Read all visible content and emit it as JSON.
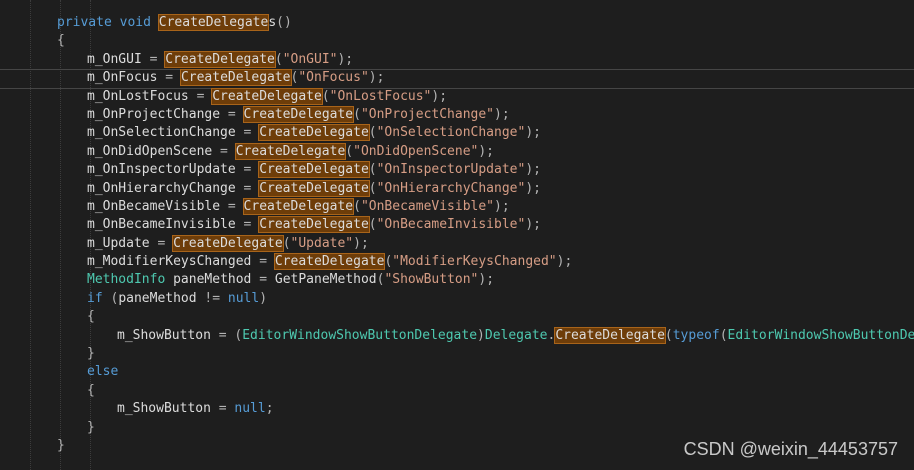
{
  "code": {
    "method_signature": {
      "keyword_private": "private",
      "keyword_void": "void",
      "method_name_highlight": "CreateDelegate",
      "method_name_suffix": "s",
      "parens": "()"
    },
    "open_brace": "{",
    "assignments": [
      {
        "target": "m_OnGUI",
        "fn": "CreateDelegate",
        "arg": "\"OnGUI\""
      },
      {
        "target": "m_OnFocus",
        "fn": "CreateDelegate",
        "arg": "\"OnFocus\""
      },
      {
        "target": "m_OnLostFocus",
        "fn": "CreateDelegate",
        "arg": "\"OnLostFocus\""
      },
      {
        "target": "m_OnProjectChange",
        "fn": "CreateDelegate",
        "arg": "\"OnProjectChange\""
      },
      {
        "target": "m_OnSelectionChange",
        "fn": "CreateDelegate",
        "arg": "\"OnSelectionChange\""
      },
      {
        "target": "m_OnDidOpenScene",
        "fn": "CreateDelegate",
        "arg": "\"OnDidOpenScene\""
      },
      {
        "target": "m_OnInspectorUpdate",
        "fn": "CreateDelegate",
        "arg": "\"OnInspectorUpdate\""
      },
      {
        "target": "m_OnHierarchyChange",
        "fn": "CreateDelegate",
        "arg": "\"OnHierarchyChange\""
      },
      {
        "target": "m_OnBecameVisible",
        "fn": "CreateDelegate",
        "arg": "\"OnBecameVisible\""
      },
      {
        "target": "m_OnBecameInvisible",
        "fn": "CreateDelegate",
        "arg": "\"OnBecameInvisible\""
      },
      {
        "target": "m_Update",
        "fn": "CreateDelegate",
        "arg": "\"Update\""
      },
      {
        "target": "m_ModifierKeysChanged",
        "fn": "CreateDelegate",
        "arg": "\"ModifierKeysChanged\""
      }
    ],
    "methodinfo_line": {
      "type": "MethodInfo",
      "var": "paneMethod",
      "call": "GetPaneMethod",
      "arg": "\"ShowButton\""
    },
    "if_line": {
      "keyword": "if",
      "var": "paneMethod",
      "op": "!=",
      "null": "null"
    },
    "inner_open_brace": "{",
    "showbutton_line": {
      "target": "m_ShowButton",
      "cast_type": "EditorWindowShowButtonDelegate",
      "class": "Delegate",
      "fn": "CreateDelegate",
      "keyword_typeof": "typeof",
      "typeof_arg": "EditorWindowShowButtonDelegat"
    },
    "inner_close_brace": "}",
    "else_keyword": "else",
    "else_open_brace": "{",
    "null_assign": {
      "target": "m_ShowButton",
      "null": "null"
    },
    "else_close_brace": "}",
    "close_brace": "}"
  },
  "watermark": "CSDN @weixin_44453757",
  "colors": {
    "background": "#1e1e1e",
    "keyword": "#569cd6",
    "string": "#d69d85",
    "type": "#4ec9b0",
    "highlight": "#6e3d09"
  }
}
